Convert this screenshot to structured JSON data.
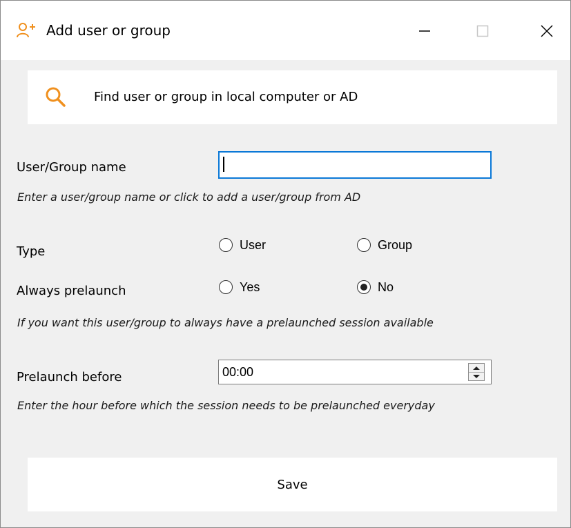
{
  "window": {
    "title": "Add user or group",
    "icon": "add-user-icon",
    "accent_color": "#f0901e",
    "controls": [
      "minimize",
      "maximize",
      "close"
    ]
  },
  "search_panel": {
    "icon": "search-icon",
    "text": "Find user or group in local computer or AD"
  },
  "name_field": {
    "label": "User/Group name",
    "value": "",
    "hint": "Enter a user/group name or click to add a user/group from AD",
    "focus_color": "#0a78d7"
  },
  "type_field": {
    "label": "Type",
    "options": [
      {
        "label": "User",
        "selected": false
      },
      {
        "label": "Group",
        "selected": false
      }
    ]
  },
  "always_prelaunch": {
    "label": "Always prelaunch",
    "options": [
      {
        "label": "Yes",
        "selected": false
      },
      {
        "label": "No",
        "selected": true
      }
    ],
    "hint": "If you want this user/group to always have a prelaunched session available"
  },
  "prelaunch_before": {
    "label": "Prelaunch before",
    "value": "00:00",
    "hint": "Enter the hour before which the session needs to be prelaunched everyday"
  },
  "save_button": {
    "label": "Save"
  }
}
